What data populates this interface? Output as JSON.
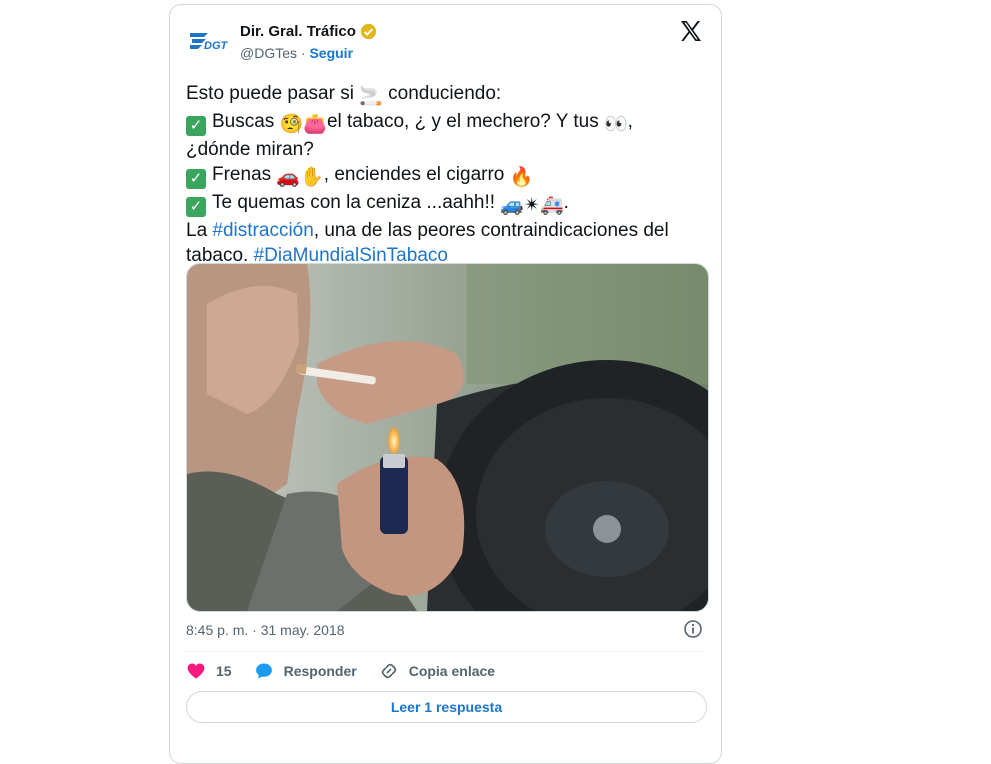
{
  "author": {
    "name": "Dir. Gral. Tráfico",
    "handle": "@DGTes",
    "separator": " · ",
    "follow_label": "Seguir",
    "logo_text": "DGT"
  },
  "tweet": {
    "line1_a": "Esto puede pasar si ",
    "line1_b": " conduciendo:",
    "line2_a": "Buscas ",
    "line2_b": "el tabaco, ¿ y el mechero? Y tus ",
    "line2_c": ",",
    "line3": "¿dónde miran?",
    "line4_a": "Frenas ",
    "line4_b": ", enciendes el cigarro ",
    "line5_a": "Te quemas con la ceniza ...aahh!! ",
    "line5_b": ".",
    "line6_a": "La ",
    "hashtag1": "#distracción",
    "line6_b": ", una de las peores contraindicaciones del",
    "line7_a": "tabaco. ",
    "hashtag2": "#DiaMundialSinTabaco",
    "emoji": {
      "smoking": "🚬",
      "monocle": "🧐",
      "purse": "👛",
      "eyes": "👀",
      "car": "🚗",
      "hand": "✋",
      "fire": "🔥",
      "car2": "🚙",
      "burst": "✴",
      "ambulance": "🚑"
    }
  },
  "meta": {
    "timestamp": "8:45 p. m. · 31 may. 2018"
  },
  "actions": {
    "likes": "15",
    "reply_label": "Responder",
    "copy_label": "Copia enlace"
  },
  "read_reply": "Leer 1 respuesta",
  "colors": {
    "accent": "#1d75c9",
    "heart": "#f91880",
    "verified": "#e2b719"
  }
}
